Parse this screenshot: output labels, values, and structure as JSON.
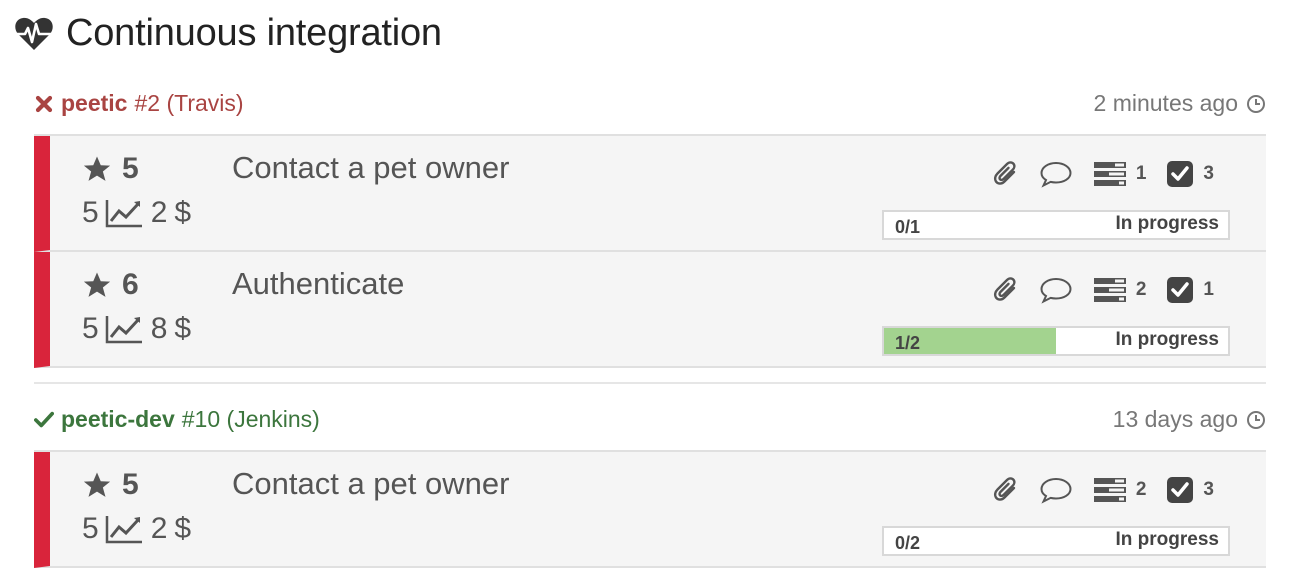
{
  "page": {
    "title": "Continuous integration",
    "icon": "heartbeat-icon"
  },
  "builds": [
    {
      "status": "failed",
      "project": "peetic",
      "number": "#2",
      "ci": "(Travis)",
      "time": "2 minutes ago",
      "colors": {
        "status": "#a94442",
        "bar": "#d9243b"
      },
      "stories": [
        {
          "priority": "5",
          "points": "5",
          "cost": "2",
          "currency": "$",
          "title": "Contact a pet owner",
          "tasks": "1",
          "checks": "3",
          "progress_label": "0/1",
          "progress_fraction": 0,
          "state": "In progress"
        },
        {
          "priority": "6",
          "points": "5",
          "cost": "8",
          "currency": "$",
          "title": "Authenticate",
          "tasks": "2",
          "checks": "1",
          "progress_label": "1/2",
          "progress_fraction": 0.5,
          "state": "In progress"
        }
      ]
    },
    {
      "status": "success",
      "project": "peetic-dev",
      "number": "#10",
      "ci": "(Jenkins)",
      "time": "13 days ago",
      "colors": {
        "status": "#3c763d",
        "bar": "#d9243b"
      },
      "stories": [
        {
          "priority": "5",
          "points": "5",
          "cost": "2",
          "currency": "$",
          "title": "Contact a pet owner",
          "tasks": "2",
          "checks": "3",
          "progress_label": "0/2",
          "progress_fraction": 0,
          "state": "In progress"
        }
      ]
    }
  ]
}
